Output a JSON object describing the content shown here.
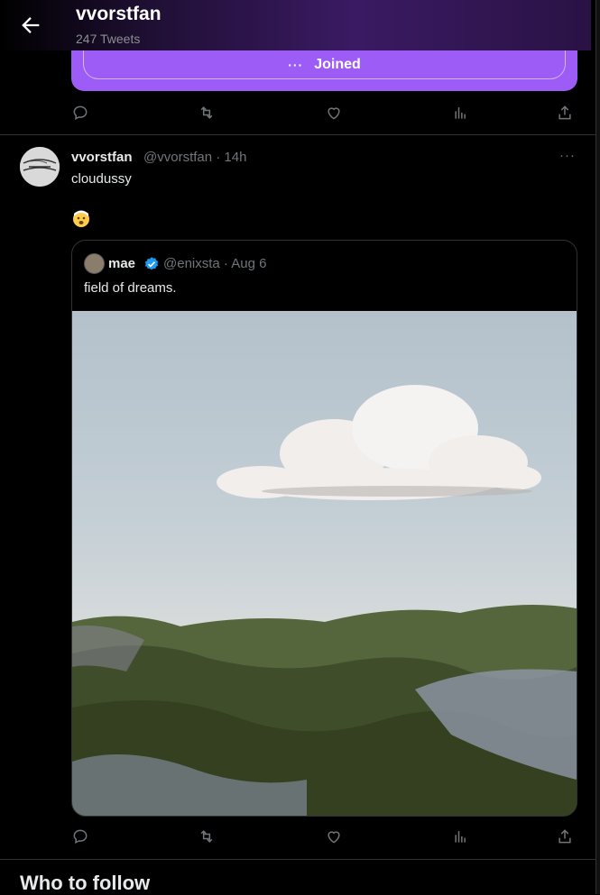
{
  "header": {
    "title": "vvorstfan",
    "subtitle": "247 Tweets"
  },
  "community_card": {
    "joined_label": "Joined",
    "menu_dots": "···"
  },
  "tweet": {
    "display_name": "vvorstfan",
    "handle_time": "@vvorstfan · 14h",
    "more": "···",
    "text": "cloudussy",
    "emoji_icon": "astonished-face-emoji"
  },
  "quoted_tweet": {
    "display_name": "mae",
    "handle_time": "@enixsta · Aug 6",
    "text": "field of dreams.",
    "verified": true,
    "image_desc_icon": "field-and-cloud-photo"
  },
  "sections": {
    "who_to_follow": "Who to follow"
  },
  "colors": {
    "accent_purple": "#9d5cf6",
    "verified_blue": "#1d9bf0",
    "muted": "#71767b",
    "border": "#2f3336"
  }
}
